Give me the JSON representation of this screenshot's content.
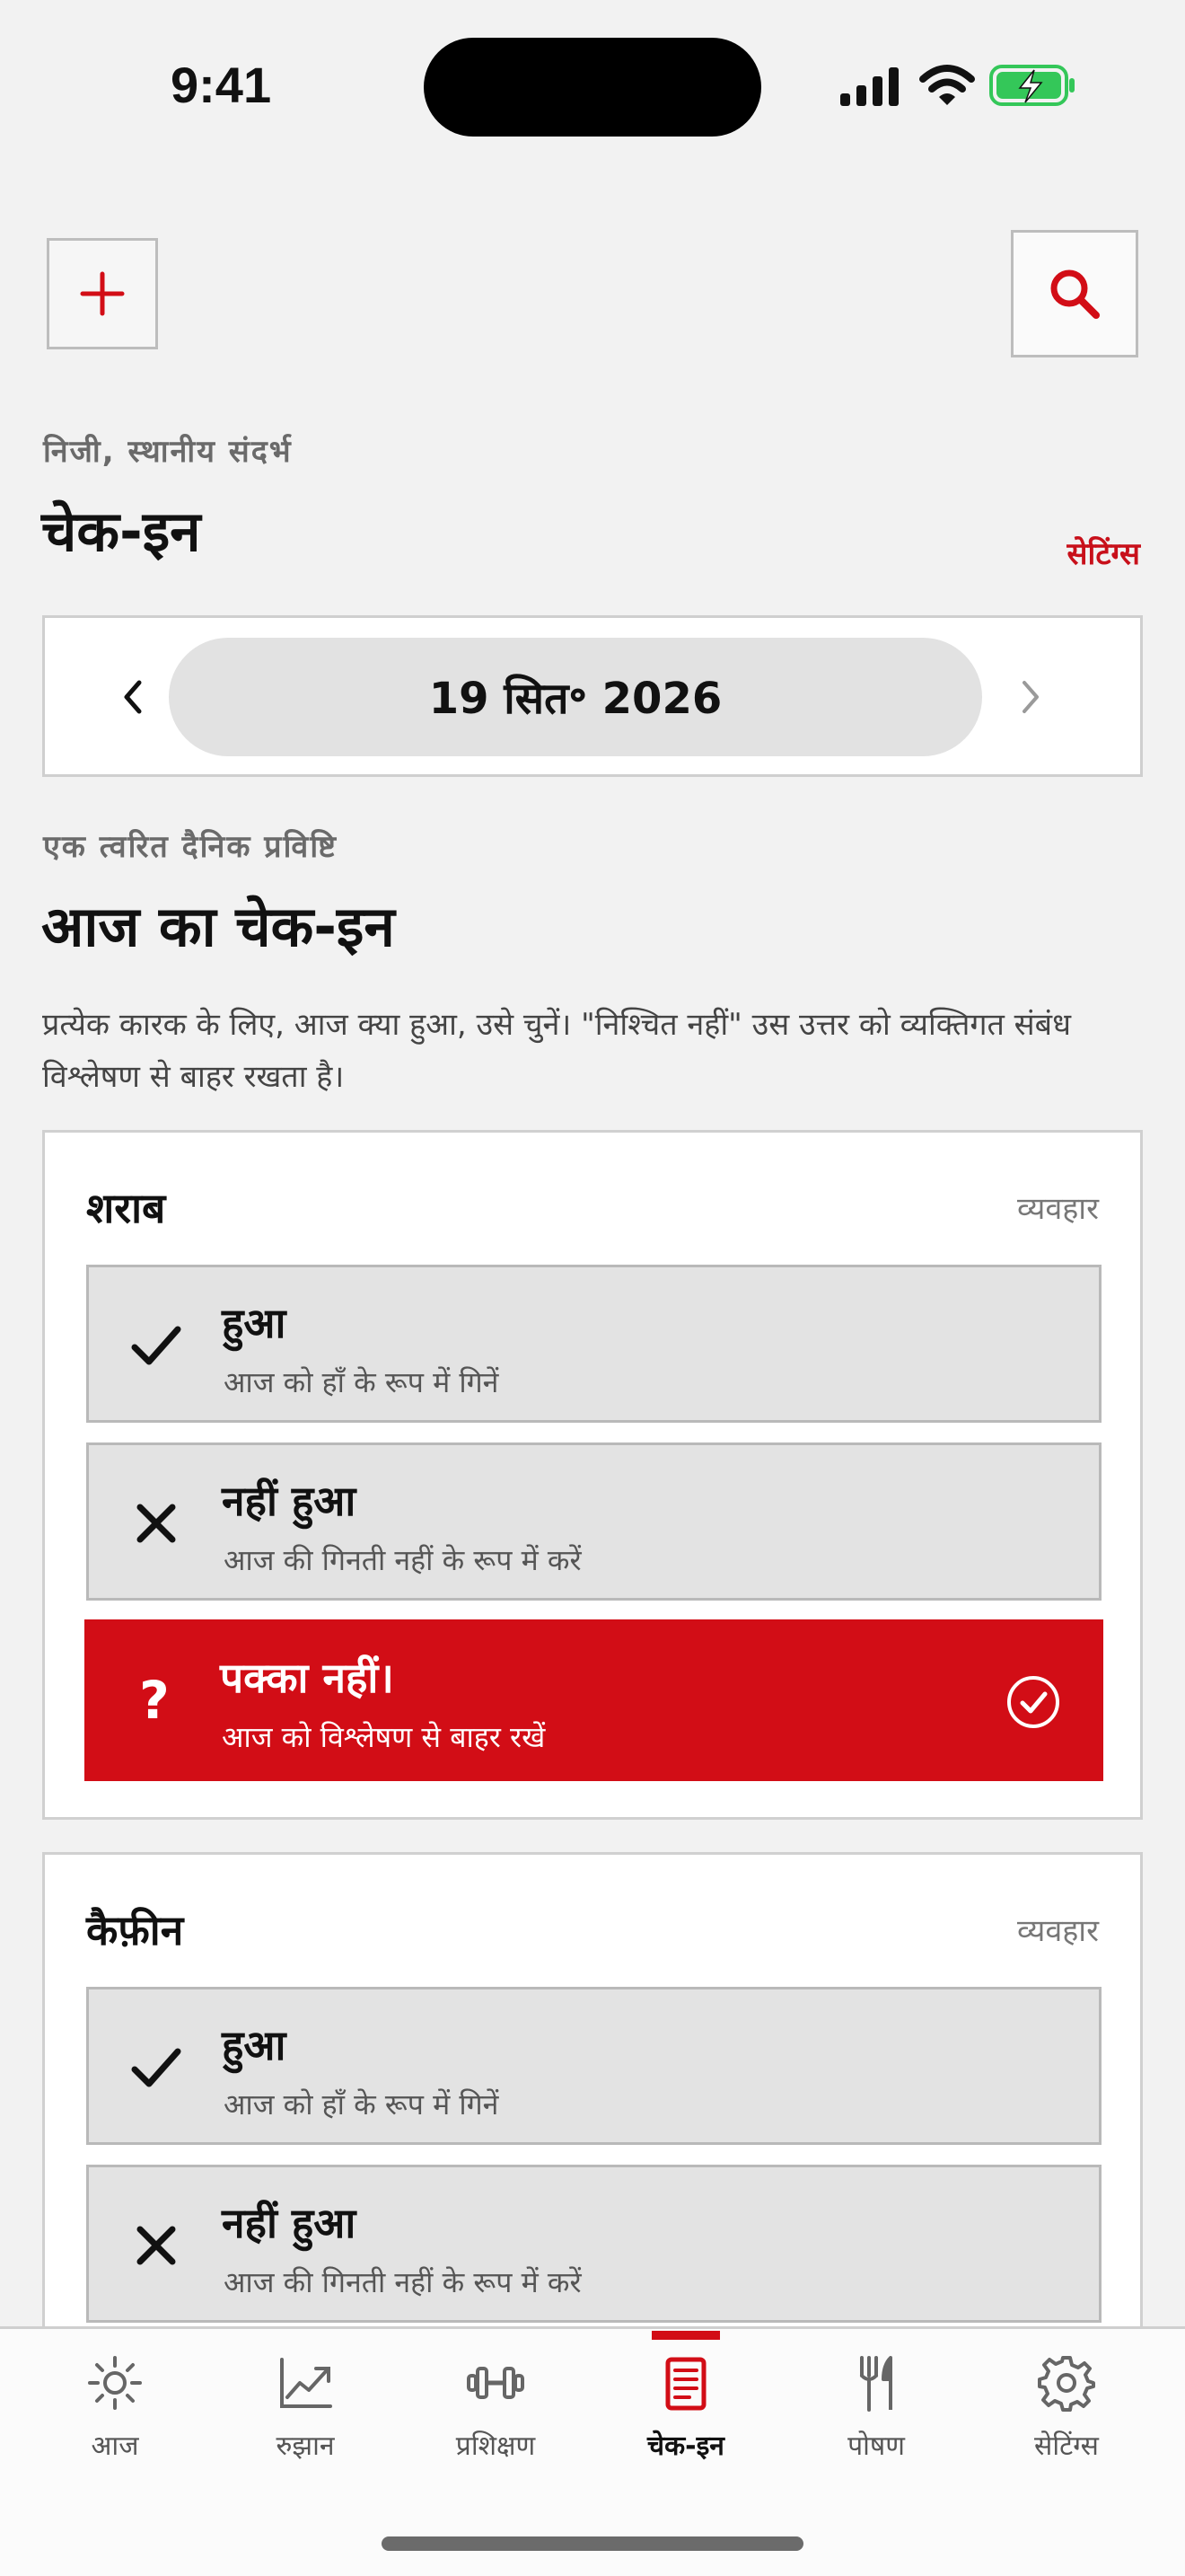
{
  "status": {
    "time": "9:41"
  },
  "header": {
    "eyebrow": "निजी, स्थानीय संदर्भ",
    "title": "चेक-इन",
    "settings_link": "सेटिंग्स"
  },
  "date_nav": {
    "date": "19 सित॰ 2026"
  },
  "section": {
    "eyebrow": "एक त्वरित दैनिक प्रविष्टि",
    "title": "आज का चेक-इन",
    "description": "प्रत्येक कारक के लिए, आज क्या हुआ, उसे चुनें। \"निश्चित नहीं\" उस उत्तर को व्यक्तिगत संबंध विश्लेषण से बाहर रखता है।"
  },
  "factors": [
    {
      "name": "शराब",
      "type": "व्यवहार",
      "options": [
        {
          "label": "हुआ",
          "sub": "आज को हाँ के रूप में गिनें",
          "icon": "check-icon"
        },
        {
          "label": "नहीं हुआ",
          "sub": "आज की गिनती नहीं के रूप में करें",
          "icon": "x-icon"
        },
        {
          "label": "पक्का नहीं।",
          "sub": "आज को विश्लेषण से बाहर रखें",
          "icon": "question-icon",
          "selected": true
        }
      ]
    },
    {
      "name": "कैफ़ीन",
      "type": "व्यवहार",
      "options": [
        {
          "label": "हुआ",
          "sub": "आज को हाँ के रूप में गिनें",
          "icon": "check-icon"
        },
        {
          "label": "नहीं हुआ",
          "sub": "आज की गिनती नहीं के रूप में करें",
          "icon": "x-icon"
        }
      ]
    }
  ],
  "tabs": [
    {
      "label": "आज",
      "icon": "sun-icon"
    },
    {
      "label": "रुझान",
      "icon": "trend-icon"
    },
    {
      "label": "प्रशिक्षण",
      "icon": "dumbbell-icon"
    },
    {
      "label": "चेक-इन",
      "icon": "checkin-icon",
      "active": true
    },
    {
      "label": "पोषण",
      "icon": "fork-knife-icon"
    },
    {
      "label": "सेटिंग्स",
      "icon": "gear-icon"
    }
  ],
  "colors": {
    "accent": "#d20d16",
    "background": "#f2f2f2",
    "option_bg": "#e3e3e3"
  }
}
